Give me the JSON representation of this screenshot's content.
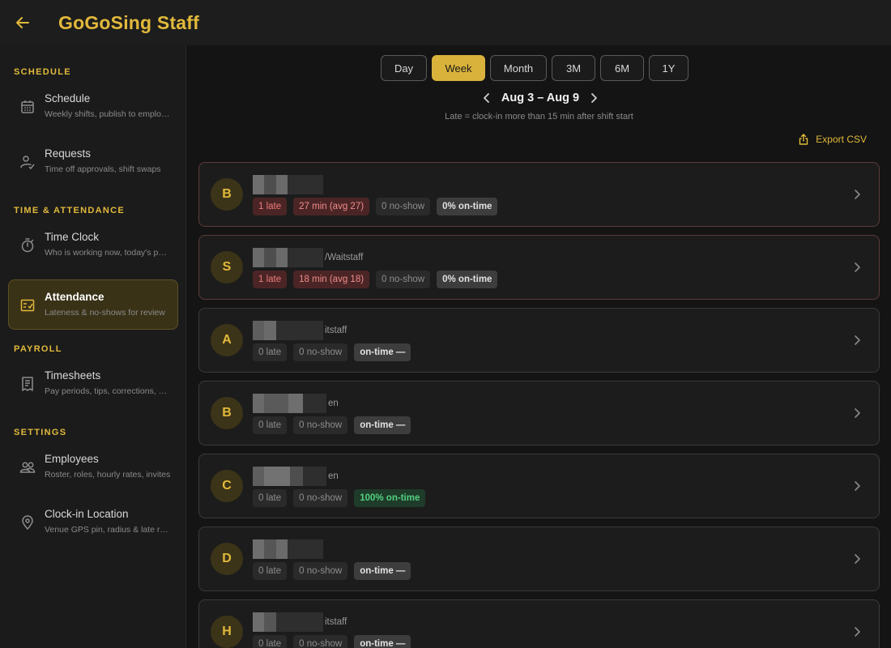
{
  "app": {
    "title": "GoGoSing Staff"
  },
  "sidebar": {
    "sections": {
      "schedule": "SCHEDULE",
      "time": "TIME & ATTENDANCE",
      "payroll": "PAYROLL",
      "settings": "SETTINGS"
    },
    "items": [
      {
        "title": "Schedule",
        "subtitle": "Weekly shifts, publish to employees",
        "icon": "calendar-icon"
      },
      {
        "title": "Requests",
        "subtitle": "Time off approvals, shift swaps",
        "icon": "person-check-icon"
      },
      {
        "title": "Time Clock",
        "subtitle": "Who is working now, today's punches",
        "icon": "stopwatch-icon"
      },
      {
        "title": "Attendance",
        "subtitle": "Lateness & no-shows for review",
        "icon": "checklist-icon",
        "active": true
      },
      {
        "title": "Timesheets",
        "subtitle": "Pay periods, tips, corrections, exports",
        "icon": "receipt-icon"
      },
      {
        "title": "Employees",
        "subtitle": "Roster, roles, hourly rates, invites",
        "icon": "people-icon"
      },
      {
        "title": "Clock-in Location",
        "subtitle": "Venue GPS pin, radius & late rules",
        "icon": "location-pin-icon"
      }
    ]
  },
  "range_tabs": [
    {
      "label": "Day"
    },
    {
      "label": "Week",
      "active": true
    },
    {
      "label": "Month"
    },
    {
      "label": "3M"
    },
    {
      "label": "6M"
    },
    {
      "label": "1Y"
    }
  ],
  "date_range": "Aug 3 – Aug 9",
  "late_note": "Late = clock-in more than 15 min after shift start",
  "export_label": "Export CSV",
  "colors": {
    "accent": "#e2b93b",
    "late": "#ef7b7b",
    "good": "#52d17e"
  },
  "employees": [
    {
      "initial": "B",
      "name_suffix": "",
      "late": "1 late",
      "minutes": "27 min (avg 27)",
      "noshow": "0 no-show",
      "ontime": "0% on-time",
      "flagged": true
    },
    {
      "initial": "S",
      "name_suffix": "/Waitstaff",
      "late": "1 late",
      "minutes": "18 min (avg 18)",
      "noshow": "0 no-show",
      "ontime": "0% on-time",
      "flagged": true
    },
    {
      "initial": "A",
      "name_suffix": "itstaff",
      "late": "0 late",
      "noshow": "0 no-show",
      "ontime": "on-time —"
    },
    {
      "initial": "B",
      "name_suffix": "en",
      "late": "0 late",
      "noshow": "0 no-show",
      "ontime": "on-time —"
    },
    {
      "initial": "C",
      "name_suffix": "en",
      "late": "0 late",
      "noshow": "0 no-show",
      "ontime": "100% on-time",
      "good": true
    },
    {
      "initial": "D",
      "name_suffix": "",
      "late": "0 late",
      "noshow": "0 no-show",
      "ontime": "on-time —"
    },
    {
      "initial": "H",
      "name_suffix": "itstaff",
      "late": "0 late",
      "noshow": "0 no-show",
      "ontime": "on-time —"
    }
  ]
}
